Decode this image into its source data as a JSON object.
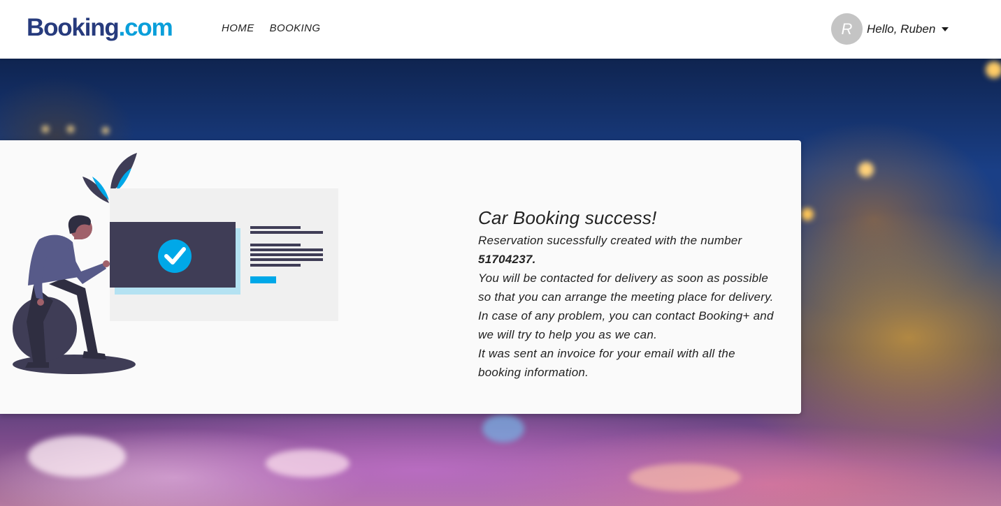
{
  "header": {
    "logo_brand": "Booking",
    "logo_tld": ".com",
    "nav": [
      "HOME",
      "BOOKING"
    ],
    "user": {
      "avatar_initial": "R",
      "greeting": "Hello, Ruben"
    }
  },
  "confirmation": {
    "title": "Car Booking success!",
    "lines": [
      "Reservation sucessfully created with the number",
      "51704237.",
      "You will be contacted for delivery as soon as possible",
      "so that you can arrange the meeting place for delivery.",
      "In case of any problem, you can contact Booking+ and",
      "we will try to help you as we can.",
      "It was sent an invoice for your email with all the",
      "booking information."
    ]
  },
  "colors": {
    "brand_blue": "#273b7d",
    "accent_blue": "#0a9fda",
    "illustration_dark": "#3f3d56",
    "illustration_accent": "#00a8e8"
  }
}
